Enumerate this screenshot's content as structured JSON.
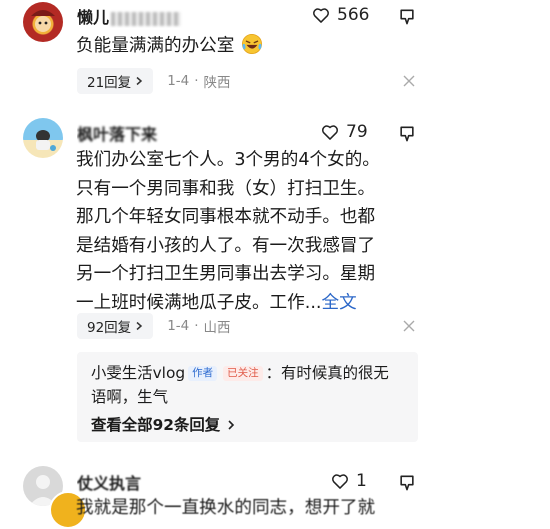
{
  "comments": [
    {
      "username": "懒儿",
      "username_obscured_suffix": "66273912",
      "likes": "566",
      "text_lines": [
        "负能量满满的办公室"
      ],
      "emoji": "laughing-crying-emoji",
      "replies": "21回复",
      "time": "1-4",
      "location": "陕西"
    },
    {
      "username": "枫叶落下来",
      "likes": "79",
      "text_lines": [
        "我们办公室七个人。3个男的4个女的。",
        "只有一个男同事和我（女）打扫卫生。",
        "那几个年轻女同事根本就不动手。也都",
        "是结婚有小孩的人了。有一次我感冒了",
        "另一个打扫卫生男同事出去学习。星期",
        "一上班时候满地瓜子皮。工作..."
      ],
      "more_label": "全文",
      "replies": "92回复",
      "time": "1-4",
      "location": "山西",
      "sub_reply": {
        "author": "小雯生活vlog",
        "author_tag": "作者",
        "follow_tag": "已关注",
        "text_line1": "：有时候真的很无",
        "text_line2": "语啊，生气",
        "view_all": "查看全部92条回复"
      }
    },
    {
      "username": "仗义执言",
      "likes": "1",
      "text_lines": [
        "我就是那个一直换水的同志，想开了就"
      ]
    }
  ],
  "separator": "·"
}
